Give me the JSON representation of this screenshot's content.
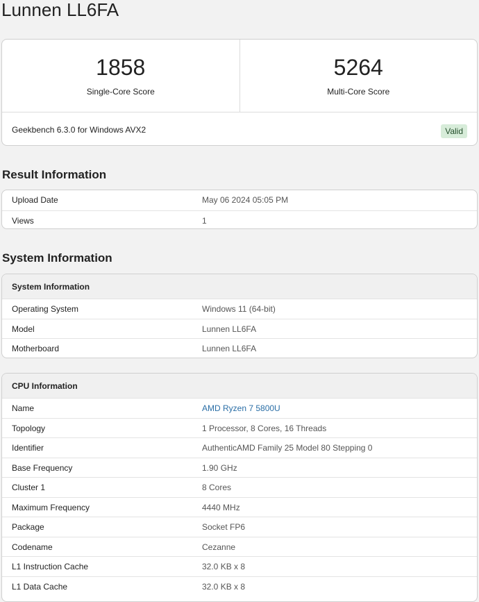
{
  "page": {
    "title": "Lunnen LL6FA"
  },
  "scores": {
    "single": {
      "value": "1858",
      "label": "Single-Core Score"
    },
    "multi": {
      "value": "5264",
      "label": "Multi-Core Score"
    },
    "version": "Geekbench 6.3.0 for Windows AVX2",
    "status": "Valid",
    "status_color": "#d7ecd9"
  },
  "result_info": {
    "title": "Result Information",
    "rows": [
      {
        "key": "Upload Date",
        "value": "May 06 2024 05:05 PM"
      },
      {
        "key": "Views",
        "value": "1"
      }
    ]
  },
  "system_info": {
    "title": "System Information",
    "card_header": "System Information",
    "rows": [
      {
        "key": "Operating System",
        "value": "Windows 11 (64-bit)"
      },
      {
        "key": "Model",
        "value": "Lunnen LL6FA"
      },
      {
        "key": "Motherboard",
        "value": "Lunnen LL6FA"
      }
    ]
  },
  "cpu_info": {
    "card_header": "CPU Information",
    "link_color": "#2a6ea6",
    "rows": [
      {
        "key": "Name",
        "value": "AMD Ryzen 7 5800U"
      },
      {
        "key": "Topology",
        "value": "1 Processor, 8 Cores, 16 Threads"
      },
      {
        "key": "Identifier",
        "value": "AuthenticAMD Family 25 Model 80 Stepping 0"
      },
      {
        "key": "Base Frequency",
        "value": "1.90 GHz"
      },
      {
        "key": "Cluster 1",
        "value": "8 Cores"
      },
      {
        "key": "Maximum Frequency",
        "value": "4440 MHz"
      },
      {
        "key": "Package",
        "value": "Socket FP6"
      },
      {
        "key": "Codename",
        "value": "Cezanne"
      },
      {
        "key": "L1 Instruction Cache",
        "value": "32.0 KB x 8"
      },
      {
        "key": "L1 Data Cache",
        "value": "32.0 KB x 8"
      }
    ]
  }
}
